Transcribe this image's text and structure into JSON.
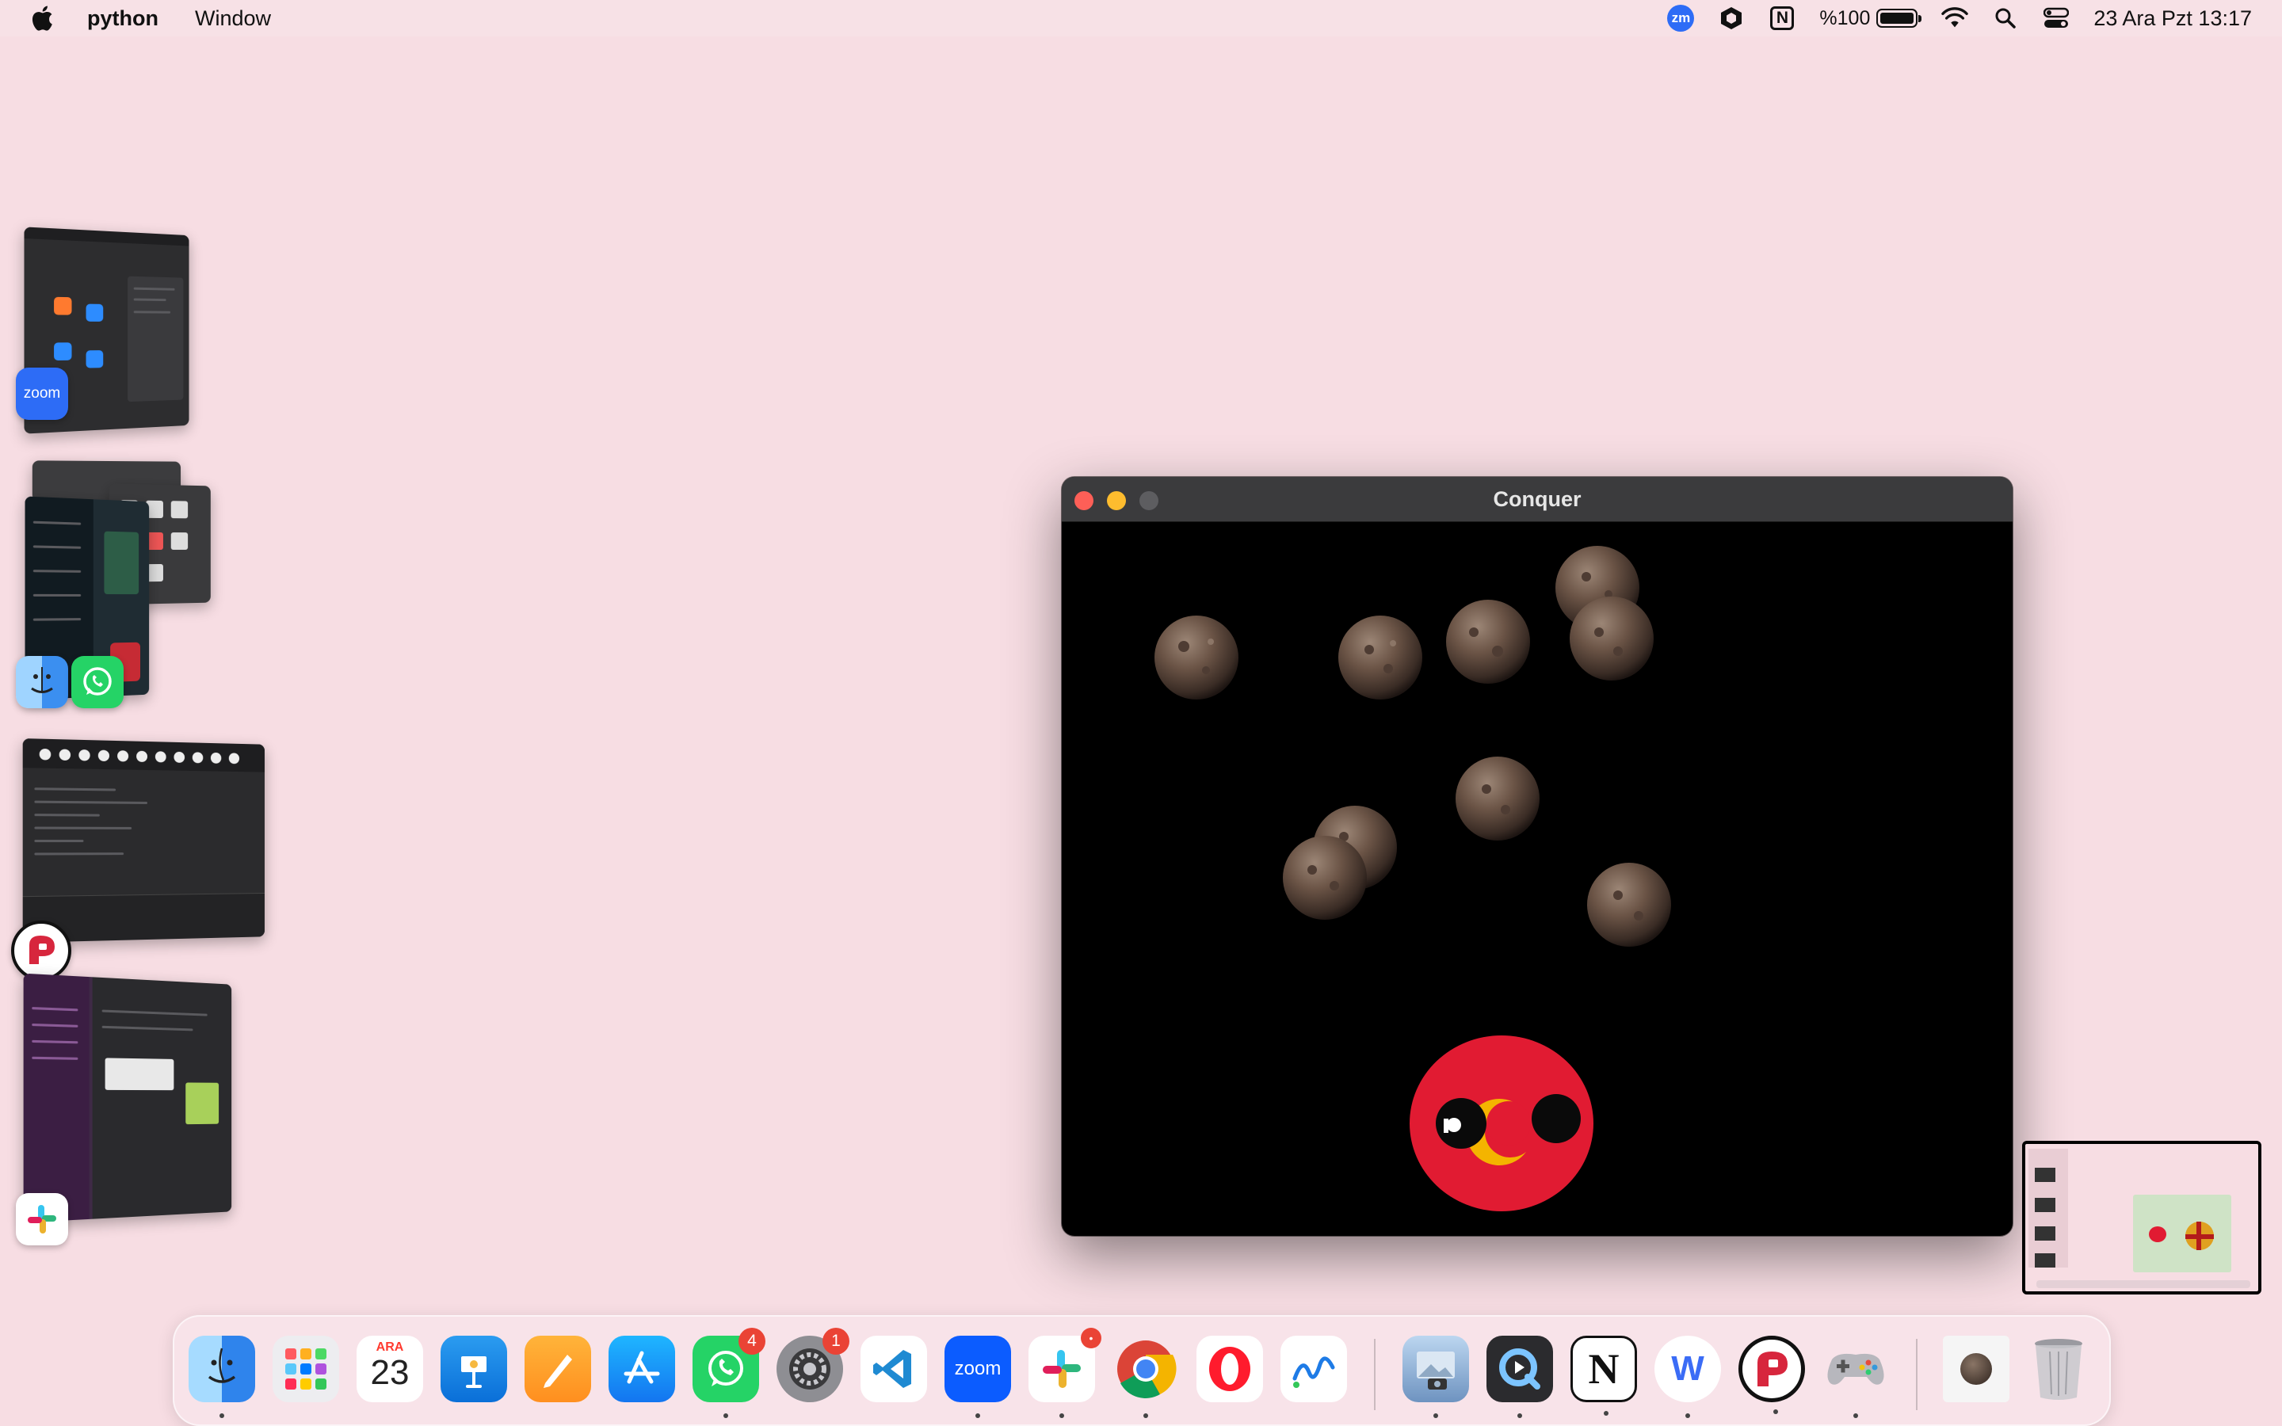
{
  "menubar": {
    "app_name": "python",
    "menu_window": "Window",
    "zoom_icon_label": "zm",
    "notion_icon_label": "N",
    "battery_text": "%100",
    "datetime": "23 Ara Pzt  13:17"
  },
  "stage_apps": [
    {
      "name": "zoom",
      "label": "zoom"
    },
    {
      "name": "finder-whatsapp",
      "label": ""
    },
    {
      "name": "python",
      "label": ""
    },
    {
      "name": "slack",
      "label": ""
    }
  ],
  "window": {
    "title": "Conquer"
  },
  "dock": {
    "calendar_month": "ARA",
    "calendar_day": "23",
    "whatsapp_badge": "4",
    "settings_badge": "1",
    "zoom_label": "zoom",
    "notion_label": "N",
    "webex_label": "W"
  },
  "colors": {
    "desktop": "#f7dde3",
    "window_bg": "#000000",
    "titlebar": "#3b3b3d",
    "ball_red": "#e11b32",
    "moon_yellow": "#f4b400",
    "rock": "#6b5446"
  }
}
